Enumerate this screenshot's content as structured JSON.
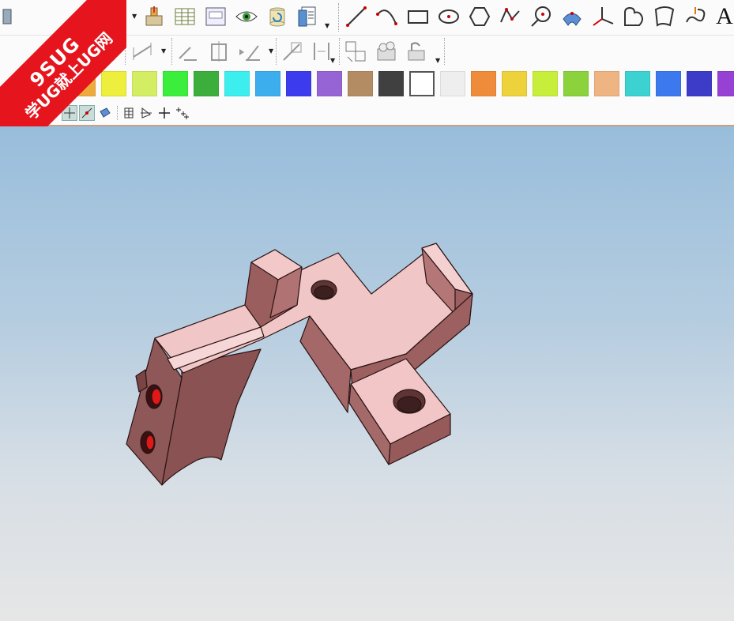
{
  "logo": {
    "line1": "9SUG",
    "line2": "学UG就上UG网",
    "color": "#e5141d"
  },
  "toolbar_row1": {
    "left_icons": [
      "draft-icon",
      "sheet-metal-icon",
      "chamfer-icon",
      "hatch-table-icon",
      "frame-icon",
      "view-eye-icon",
      "cylinder-refresh-icon",
      "document-properties-icon"
    ],
    "curve_icons": [
      "line-icon",
      "arc-icon",
      "rectangle-icon",
      "ellipse-icon",
      "polygon-icon",
      "studio-spline-icon",
      "circle-point-icon",
      "fillet-curve-icon",
      "datum-csys-icon",
      "chain-curve-icon",
      "bounded-plane-icon",
      "helix-icon"
    ],
    "text_tool": "A"
  },
  "toolbar_row2": {
    "icons": [
      "trim-corner-icon",
      "intersect-point-icon",
      "dimension-icon",
      "parallel-constraint-icon",
      "split-icon",
      "angular-constraint-icon",
      "layout-icon",
      "offset-icon",
      "mirror-icon",
      "pattern-icon",
      "transform-icon",
      "move-object-icon"
    ]
  },
  "color_palette": [
    "#ee3cee",
    "#eeaa3c",
    "#eeee3c",
    "#d4ee64",
    "#3cee3c",
    "#3cae3c",
    "#3ceeee",
    "#3caeee",
    "#3c3cee",
    "#9664d4",
    "#b48c64",
    "#404040",
    "#ffffff",
    "#eeeeee",
    "#ee8c3c",
    "#eed23c",
    "#c8ee3c",
    "#8cd23c",
    "#eeb482",
    "#3cd2d2",
    "#3c78ee",
    "#3c3cc8",
    "#9640d4"
  ],
  "snap_toolbar": {
    "icons": [
      "end-point-icon",
      "center-point-icon",
      "quadrant-point-icon",
      "existing-point-icon",
      "point-on-curve-icon",
      "point-on-face-icon",
      "grid-icon",
      "selection-filter-icon",
      "crosshair-icon",
      "snap-points-icon"
    ]
  },
  "viewport": {
    "model": "3d-bracket-part",
    "part_color": "#f2c4c4",
    "top_color": "#b0d2e8",
    "bottom_color": "#e6e6e6"
  }
}
